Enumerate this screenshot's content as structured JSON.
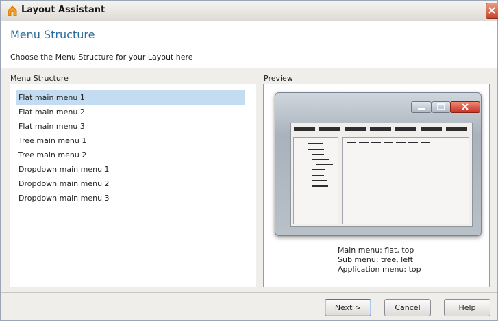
{
  "window": {
    "title": "Layout Assistant",
    "close_icon": "close-icon",
    "app_icon": "assistant-app-icon"
  },
  "header": {
    "title": "Menu Structure",
    "subtitle": "Choose the Menu Structure for your Layout here"
  },
  "menu_structure": {
    "label": "Menu Structure",
    "items": [
      {
        "label": "Flat main menu 1",
        "selected": true
      },
      {
        "label": "Flat main menu 2",
        "selected": false
      },
      {
        "label": "Flat main menu 3",
        "selected": false
      },
      {
        "label": "Tree main menu 1",
        "selected": false
      },
      {
        "label": "Tree main menu 2",
        "selected": false
      },
      {
        "label": "Dropdown main menu 1",
        "selected": false
      },
      {
        "label": "Dropdown main menu 2",
        "selected": false
      },
      {
        "label": "Dropdown main menu 3",
        "selected": false
      }
    ]
  },
  "preview": {
    "label": "Preview",
    "description": [
      "Main menu: flat, top",
      "Sub menu: tree, left",
      "Application menu: top"
    ]
  },
  "buttons": {
    "next": "Next >",
    "cancel": "Cancel",
    "help": "Help"
  },
  "colors": {
    "accent_title": "#2a6b9a",
    "selection": "#c3dcf1",
    "close_red": "#c7432a"
  }
}
